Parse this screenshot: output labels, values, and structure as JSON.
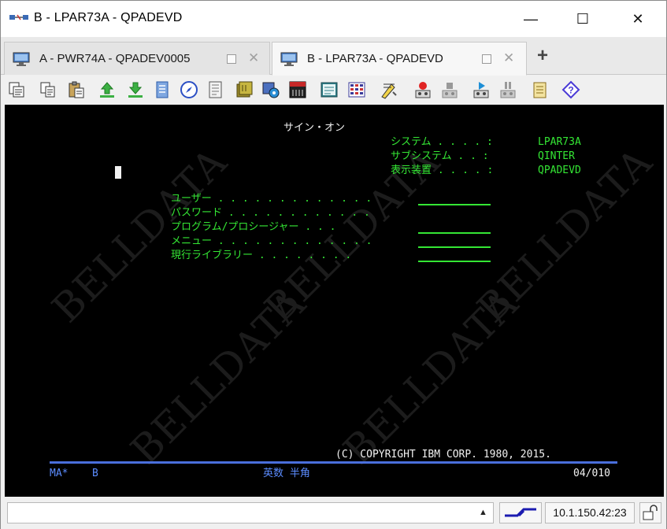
{
  "window": {
    "title": "B - LPAR73A - QPADEVD",
    "minimize_glyph": "—",
    "maximize_glyph": "☐",
    "close_glyph": "✕"
  },
  "tabs": [
    {
      "label": "A - PWR74A - QPADEV0005",
      "active": false
    },
    {
      "label": "B - LPAR73A - QPADEVD",
      "active": true
    }
  ],
  "new_tab_glyph": "+",
  "toolbar": {
    "icons": [
      "print-screen-icon",
      "copy-icon",
      "paste-icon",
      "send-file-icon",
      "receive-file-icon",
      "macro-icon",
      "navigator-icon",
      "notes-icon",
      "archive-icon",
      "settings-icon",
      "sql-icon",
      "display-icon",
      "keypad-icon",
      "edit-tools-icon",
      "record-icon",
      "stop-record-icon",
      "play-macro-icon",
      "pause-icon",
      "clipboard-icon",
      "help-icon"
    ]
  },
  "terminal": {
    "title": "サイン・オン",
    "info": [
      {
        "label": "システム . . . . :",
        "value": "LPAR73A"
      },
      {
        "label": "サブシステム . . :",
        "value": "QINTER"
      },
      {
        "label": "表示装置 . . . . :",
        "value": "QPADEVD"
      }
    ],
    "fields": [
      {
        "label": "ユーザー . . . . . . . . . . . . ."
      },
      {
        "label": "パスワード . . . . . . . . . . . ."
      },
      {
        "label": "プログラム/プロシージャー . . ."
      },
      {
        "label": "メニュー . . . . . . . . . . . . ."
      },
      {
        "label": "現行ライブラリー . . . . . . . ."
      }
    ],
    "copyright": "(C) COPYRIGHT IBM CORP. 1980, 2015.",
    "watermark": "BELLDATA",
    "oia": {
      "left": "MA*",
      "session": "B",
      "mode": "英数 半角",
      "position": "04/010"
    }
  },
  "status": {
    "ip": "10.1.150.42:23",
    "arrow": "▲"
  },
  "colors": {
    "terminal_bg": "#000000",
    "terminal_green": "#34e634",
    "terminal_blue": "#5b8cff"
  }
}
